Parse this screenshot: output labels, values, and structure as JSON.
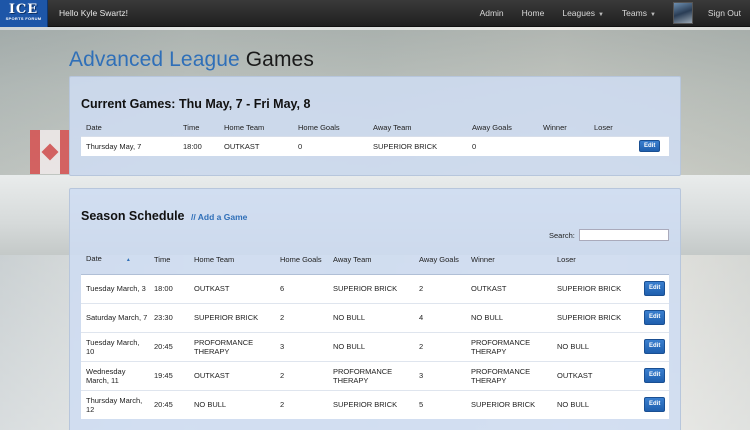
{
  "navbar": {
    "logo_main": "ICE",
    "logo_sub": "SPORTS FORUM",
    "greeting": "Hello Kyle Swartz!",
    "links": [
      "Admin",
      "Home",
      "Leagues",
      "Teams",
      "Sign Out"
    ]
  },
  "page": {
    "title_accent": "Advanced League",
    "title_rest": "Games"
  },
  "current_games": {
    "heading": "Current Games: Thu May, 7 - Fri May, 8",
    "columns": [
      "Date",
      "Time",
      "Home Team",
      "Home Goals",
      "Away Team",
      "Away Goals",
      "Winner",
      "Loser",
      ""
    ],
    "rows": [
      [
        "Thursday May, 7",
        "18:00",
        "OUTKAST",
        "0",
        "SUPERIOR BRICK",
        "0",
        "",
        ""
      ]
    ],
    "edit_label": "Edit"
  },
  "season": {
    "heading": "Season Schedule",
    "add_link": "// Add a Game",
    "search_label": "Search:",
    "columns": [
      "Date",
      "Time",
      "Home Team",
      "Home Goals",
      "Away Team",
      "Away Goals",
      "Winner",
      "Loser",
      ""
    ],
    "rows": [
      [
        "Tuesday March, 3",
        "18:00",
        "OUTKAST",
        "6",
        "SUPERIOR BRICK",
        "2",
        "OUTKAST",
        "SUPERIOR BRICK"
      ],
      [
        "Saturday March, 7",
        "23:30",
        "SUPERIOR BRICK",
        "2",
        "NO BULL",
        "4",
        "NO BULL",
        "SUPERIOR BRICK"
      ],
      [
        "Tuesday March, 10",
        "20:45",
        "PROFORMANCE THERAPY",
        "3",
        "NO BULL",
        "2",
        "PROFORMANCE THERAPY",
        "NO BULL"
      ],
      [
        "Wednesday March, 11",
        "19:45",
        "OUTKAST",
        "2",
        "PROFORMANCE THERAPY",
        "3",
        "PROFORMANCE THERAPY",
        "OUTKAST"
      ],
      [
        "Thursday March, 12",
        "20:45",
        "NO BULL",
        "2",
        "SUPERIOR BRICK",
        "5",
        "SUPERIOR BRICK",
        "NO BULL"
      ]
    ],
    "edit_label": "Edit"
  }
}
